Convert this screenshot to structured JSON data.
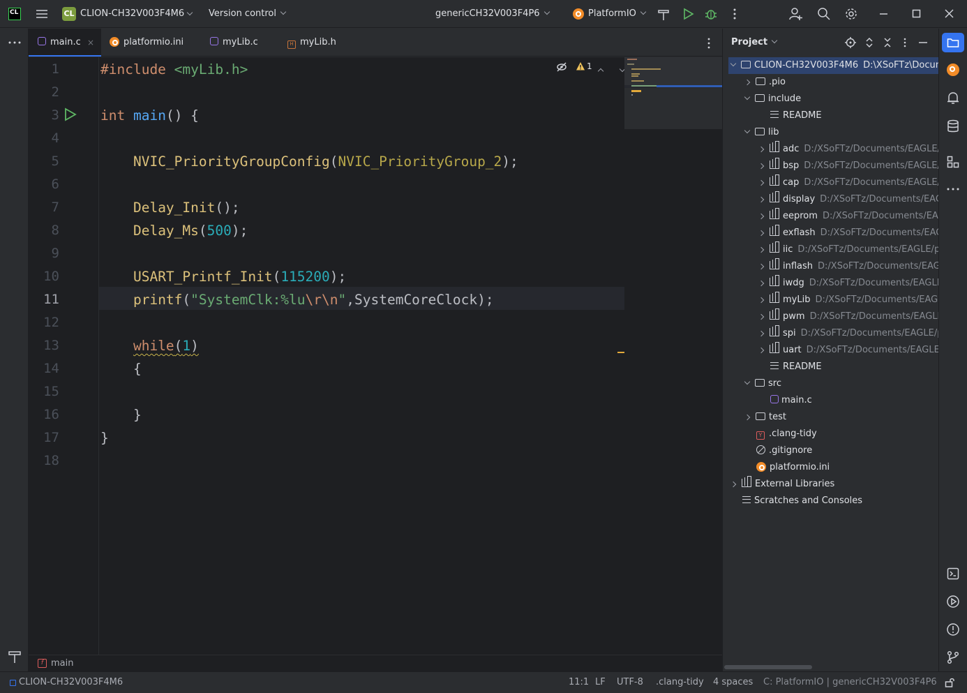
{
  "titlebar": {
    "app_icon": "CL",
    "project_badge": "CL",
    "project_name": "CLION-CH32V003F4M6",
    "vcs_label": "Version control",
    "config_name": "genericCH32V003F4P6",
    "platformio_label": "PlatformIO",
    "icons": [
      "hamburger-menu-icon",
      "build-hammer-icon",
      "run-icon",
      "debug-bug-icon",
      "more-icon",
      "add-user-icon",
      "search-icon",
      "gear-icon",
      "minimize-icon",
      "maximize-icon",
      "close-icon"
    ]
  },
  "tabs": [
    {
      "label": "main.c",
      "type": "c",
      "active": true
    },
    {
      "label": "platformio.ini",
      "type": "ini",
      "active": false
    },
    {
      "label": "myLib.c",
      "type": "c",
      "active": false
    },
    {
      "label": "myLib.h",
      "type": "h",
      "active": false
    }
  ],
  "editor": {
    "inspection_warning_count": "1",
    "current_line": 11,
    "line_numbers": [
      "1",
      "2",
      "3",
      "4",
      "5",
      "6",
      "7",
      "8",
      "9",
      "10",
      "11",
      "12",
      "13",
      "14",
      "15",
      "16",
      "17",
      "18"
    ],
    "lines": {
      "l1_directive": "#include",
      "l1_header": "<myLib.h>",
      "l3_type": "int",
      "l3_name": "main",
      "l3_rest": "() {",
      "l5_fn": "NVIC_PriorityGroupConfig",
      "l5_open": "(",
      "l5_arg": "NVIC_PriorityGroup_2",
      "l5_close": ");",
      "l7_fn": "Delay_Init",
      "l7_rest": "();",
      "l8_fn": "Delay_Ms",
      "l8_open": "(",
      "l8_num": "500",
      "l8_close": ");",
      "l10_fn": "USART_Printf_Init",
      "l10_open": "(",
      "l10_num": "115200",
      "l10_close": ");",
      "l11_fn": "printf",
      "l11_open": "(",
      "l11_str1": "\"SystemClk:%lu",
      "l11_esc1": "\\r",
      "l11_esc2": "\\n",
      "l11_str2": "\"",
      "l11_rest": ",SystemCoreClock);",
      "l13_kw": "while",
      "l13_open": "(",
      "l13_num": "1",
      "l13_close": ")",
      "l14": "{",
      "l16": "}",
      "l17": "}"
    }
  },
  "breadcrumb": {
    "function": "main"
  },
  "project_panel": {
    "title": "Project",
    "root_name": "CLION-CH32V003F4M6",
    "root_path": "D:\\XSoFTz\\Docum",
    "items": [
      {
        "label": ".pio",
        "path": ""
      },
      {
        "label": "include",
        "path": ""
      },
      {
        "label": "README",
        "path": ""
      },
      {
        "label": "lib",
        "path": ""
      },
      {
        "label": "adc",
        "path": "D:/XSoFTz/Documents/EAGLE/p"
      },
      {
        "label": "bsp",
        "path": "D:/XSoFTz/Documents/EAGLE/"
      },
      {
        "label": "cap",
        "path": "D:/XSoFTz/Documents/EAGLE/p"
      },
      {
        "label": "display",
        "path": "D:/XSoFTz/Documents/EAG"
      },
      {
        "label": "eeprom",
        "path": "D:/XSoFTz/Documents/EAG"
      },
      {
        "label": "exflash",
        "path": "D:/XSoFTz/Documents/EAG"
      },
      {
        "label": "iic",
        "path": "D:/XSoFTz/Documents/EAGLE/pr"
      },
      {
        "label": "inflash",
        "path": "D:/XSoFTz/Documents/EAGL"
      },
      {
        "label": "iwdg",
        "path": "D:/XSoFTz/Documents/EAGLE"
      },
      {
        "label": "myLib",
        "path": "D:/XSoFTz/Documents/EAGL"
      },
      {
        "label": "pwm",
        "path": "D:/XSoFTz/Documents/EAGLE"
      },
      {
        "label": "spi",
        "path": "D:/XSoFTz/Documents/EAGLE/p"
      },
      {
        "label": "uart",
        "path": "D:/XSoFTz/Documents/EAGLE/"
      },
      {
        "label": "README",
        "path": ""
      },
      {
        "label": "src",
        "path": ""
      },
      {
        "label": "main.c",
        "path": ""
      },
      {
        "label": "test",
        "path": ""
      },
      {
        "label": ".clang-tidy",
        "path": ""
      },
      {
        "label": ".gitignore",
        "path": ""
      },
      {
        "label": "platformio.ini",
        "path": ""
      },
      {
        "label": "External Libraries",
        "path": ""
      },
      {
        "label": "Scratches and Consoles",
        "path": ""
      }
    ]
  },
  "statusbar": {
    "project": "CLION-CH32V003F4M6",
    "position": "11:1",
    "line_ending": "LF",
    "encoding": "UTF-8",
    "linter": ".clang-tidy",
    "indent": "4 spaces",
    "context": "C: PlatformIO | genericCH32V003F4P6"
  },
  "colors": {
    "background": "#1e1f22",
    "panel": "#2b2d30",
    "accent": "#3574f0",
    "keyword": "#cf8e6d",
    "function": "#dcc17b",
    "number": "#2aacb8",
    "string": "#6aab73",
    "warning": "#f2c55c",
    "run_green": "#5fb865"
  }
}
